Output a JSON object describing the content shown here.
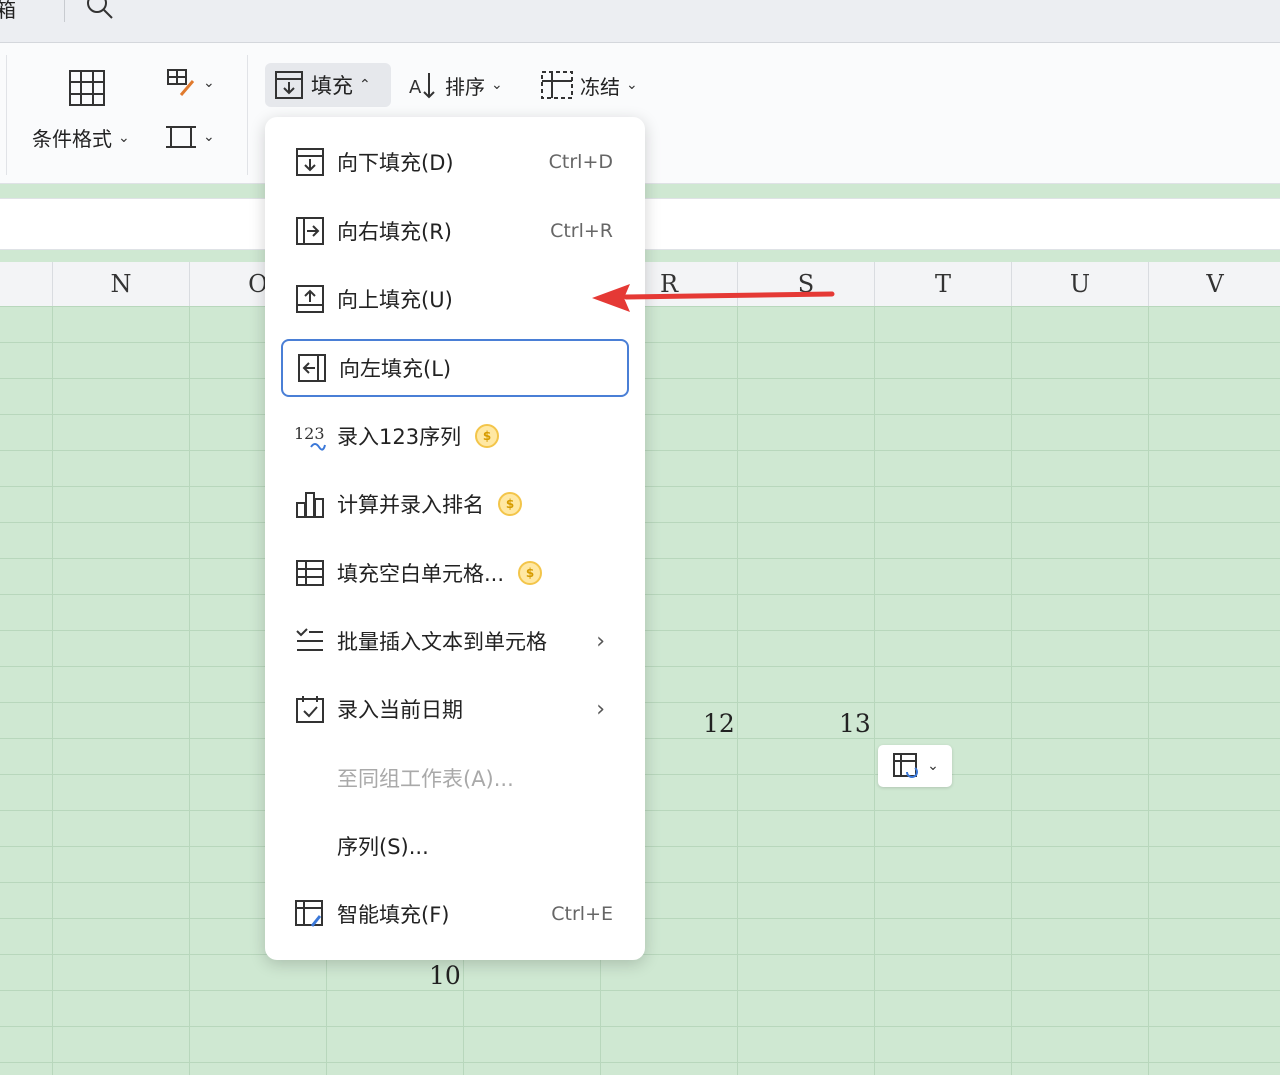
{
  "topbar": {
    "cut_text": "箱"
  },
  "ribbon": {
    "conditional_format": "条件格式",
    "fill": "填充",
    "sort": "排序",
    "freeze": "冻结"
  },
  "columns": [
    "N",
    "O",
    "R",
    "S",
    "T",
    "U",
    "V"
  ],
  "cells": {
    "a": "12",
    "b": "13",
    "c": "10"
  },
  "menu": {
    "items": [
      {
        "label": "向下填充(D)",
        "shortcut": "Ctrl+D"
      },
      {
        "label": "向右填充(R)",
        "shortcut": "Ctrl+R"
      },
      {
        "label": "向上填充(U)"
      },
      {
        "label": "向左填充(L)"
      },
      {
        "label": "录入123序列"
      },
      {
        "label": "计算并录入排名"
      },
      {
        "label": "填充空白单元格..."
      },
      {
        "label": "批量插入文本到单元格"
      },
      {
        "label": "录入当前日期"
      },
      {
        "label": "至同组工作表(A)..."
      },
      {
        "label": "序列(S)..."
      },
      {
        "label": "智能填充(F)",
        "shortcut": "Ctrl+E"
      }
    ],
    "badge_symbol": "$",
    "icon_123": "123"
  },
  "colors": {
    "sheet_bg": "#cfe8d2",
    "menu_focus": "#4a7fd6",
    "arrow": "#e53935"
  }
}
